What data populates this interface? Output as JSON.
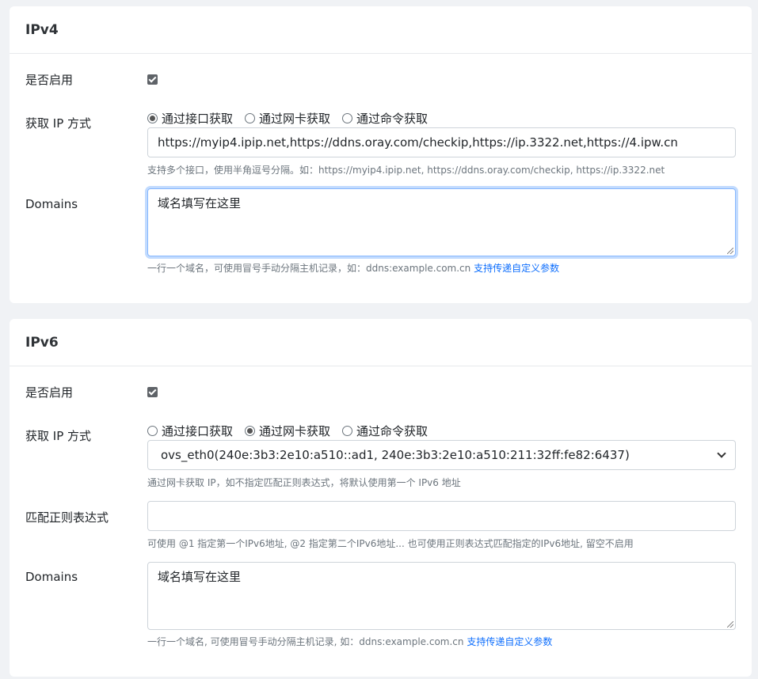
{
  "ipv4": {
    "title": "IPv4",
    "enable_label": "是否启用",
    "enabled": true,
    "method_label": "获取 IP 方式",
    "methods": [
      "通过接口获取",
      "通过网卡获取",
      "通过命令获取"
    ],
    "selected_method": 0,
    "url_value": "https://myip4.ipip.net,https://ddns.oray.com/checkip,https://ip.3322.net,https://4.ipw.cn",
    "url_help": "支持多个接口，使用半角逗号分隔。如：https://myip4.ipip.net, https://ddns.oray.com/checkip, https://ip.3322.net",
    "domains_label": "Domains",
    "domains_placeholder": "域名填写在这里",
    "domains_help": "一行一个域名，可使用冒号手动分隔主机记录，如：ddns:example.com.cn",
    "domains_help_link": "支持传递自定义参数"
  },
  "ipv6": {
    "title": "IPv6",
    "enable_label": "是否启用",
    "enabled": true,
    "method_label": "获取 IP 方式",
    "methods": [
      "通过接口获取",
      "通过网卡获取",
      "通过命令获取"
    ],
    "selected_method": 1,
    "nic_selected": "ovs_eth0(240e:3b3:2e10:a510::ad1, 240e:3b3:2e10:a510:211:32ff:fe82:6437)",
    "nic_help": "通过网卡获取 IP，如不指定匹配正则表达式，将默认使用第一个 IPv6 地址",
    "regex_label": "匹配正则表达式",
    "regex_value": "",
    "regex_help": "可使用 @1 指定第一个IPv6地址, @2 指定第二个IPv6地址... 也可使用正则表达式匹配指定的IPv6地址, 留空不启用",
    "domains_label": "Domains",
    "domains_placeholder": "域名填写在这里",
    "domains_help": "一行一个域名, 可使用冒号手动分隔主机记录, 如：ddns:example.com.cn",
    "domains_help_link": "支持传递自定义参数"
  }
}
